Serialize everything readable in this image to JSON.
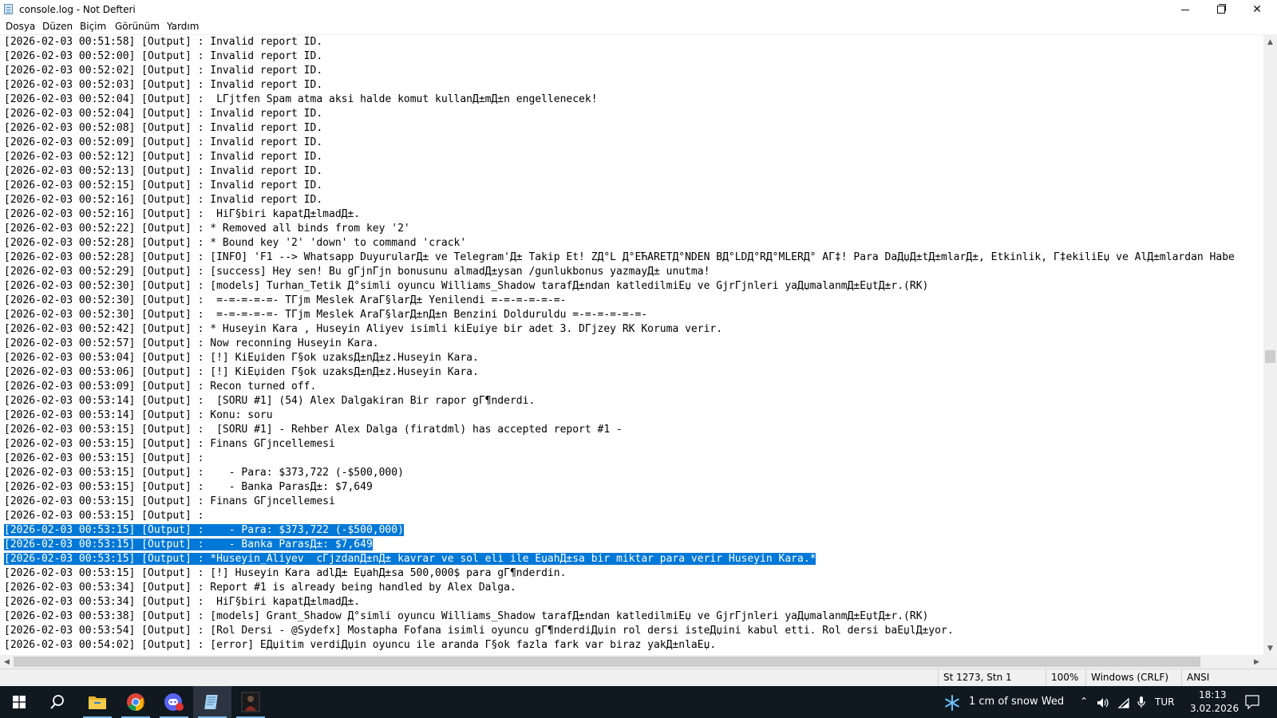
{
  "window": {
    "title": "console.log - Not Defteri"
  },
  "menu": [
    "Dosya",
    "Düzen",
    "Biçim",
    "Görünüm",
    "Yardım"
  ],
  "log_lines": [
    {
      "pre": "[2026-02-03 00:51:58] [Output] : Invalid report ID."
    },
    {
      "pre": "[2026-02-03 00:52:00] [Output] : Invalid report ID."
    },
    {
      "pre": "[2026-02-03 00:52:02] [Output] : Invalid report ID."
    },
    {
      "pre": "[2026-02-03 00:52:03] [Output] : Invalid report ID."
    },
    {
      "pre": "[2026-02-03 00:52:04] [Output] :  LГјtfen Spam atma aksi halde komut kullanД±mД±n engellenecek!"
    },
    {
      "pre": "[2026-02-03 00:52:04] [Output] : Invalid report ID."
    },
    {
      "pre": "[2026-02-03 00:52:08] [Output] : Invalid report ID."
    },
    {
      "pre": "[2026-02-03 00:52:09] [Output] : Invalid report ID."
    },
    {
      "pre": "[2026-02-03 00:52:12] [Output] : Invalid report ID."
    },
    {
      "pre": "[2026-02-03 00:52:13] [Output] : Invalid report ID."
    },
    {
      "pre": "[2026-02-03 00:52:15] [Output] : Invalid report ID."
    },
    {
      "pre": "[2026-02-03 00:52:16] [Output] : Invalid report ID."
    },
    {
      "pre": "[2026-02-03 00:52:16] [Output] :  HiГ§biri kapatД±lmadД±."
    },
    {
      "pre": "[2026-02-03 00:52:22] [Output] : * Removed all binds from key '2'"
    },
    {
      "pre": "[2026-02-03 00:52:28] [Output] : * Bound key '2' 'down' to command 'crack'"
    },
    {
      "pre": "[2026-02-03 00:52:28] [Output] : [INFO] 'F1 --> Whatsapp DuyurularД± ve Telegram'Д± Takip Et! ZД°L Д°EЋARETД°NDEN BД°LDД°RД°MLERД° AГ‡! Para DaДџД±tД±mlarД±, Etkinlik, Г‡ekiliЕџ ve AlД±mlardan Habe"
    },
    {
      "pre": "[2026-02-03 00:52:29] [Output] : [success] Hey sen! Bu gГјnГјn bonusunu almadД±ysan /gunlukbonus yazmayД± unutma!"
    },
    {
      "pre": "[2026-02-03 00:52:30] [Output] : [models] Turhan_Tetik Д°simli oyuncu Williams_Shadow tarafД±ndan katledilmiЕџ ve GјrГјnleri yaДџmalanmД±ЕџtД±r.(RK)"
    },
    {
      "pre": "[2026-02-03 00:52:30] [Output] :  =-=-=-=-=- TГјm Meslek AraГ§larД± Yenilendi =-=-=-=-=-=-"
    },
    {
      "pre": "[2026-02-03 00:52:30] [Output] :  =-=-=-=-=- TГјm Meslek AraГ§larД±nД±n Benzini Dolduruldu =-=-=-=-=-=-"
    },
    {
      "pre": "[2026-02-03 00:52:42] [Output] : * Huseyin Kara , Huseyin Aliyev isimli kiЕџiye bir adet 3. DГјzey RK Koruma verir."
    },
    {
      "pre": "[2026-02-03 00:52:57] [Output] : Now reconning Huseyin Kara."
    },
    {
      "pre": "[2026-02-03 00:53:04] [Output] : [!] KiЕџiden Г§ok uzaksД±nД±z.Huseyin Kara."
    },
    {
      "pre": "[2026-02-03 00:53:06] [Output] : [!] KiЕџiden Г§ok uzaksД±nД±z.Huseyin Kara."
    },
    {
      "pre": "[2026-02-03 00:53:09] [Output] : Recon turned off."
    },
    {
      "pre": "[2026-02-03 00:53:14] [Output] :  [SORU #1] (54) Alex Dalgakiran Bir rapor gГ¶nderdi."
    },
    {
      "pre": "[2026-02-03 00:53:14] [Output] : Konu: soru"
    },
    {
      "pre": "[2026-02-03 00:53:15] [Output] :  [SORU #1] - Rehber Alex Dalga (firatdml) has accepted report #1 -"
    },
    {
      "pre": "[2026-02-03 00:53:15] [Output] : Finans GГјncellemesi"
    },
    {
      "pre": "[2026-02-03 00:53:15] [Output] :"
    },
    {
      "pre": "[2026-02-03 00:53:15] [Output] :    - Para: $373,722 (-$500,000)"
    },
    {
      "pre": "[2026-02-03 00:53:15] [Output] :    - Banka ParasД±: $7,649"
    },
    {
      "pre": "[2026-02-03 00:53:15] [Output] : Finans GГјncellemesi"
    },
    {
      "pre": "[2026-02-03 00:53:15] [Output] :"
    },
    {
      "pre": "",
      "sel": "[2026-02-03 00:53:15] [Output] :    - Para: $373,722 (-$500,000)"
    },
    {
      "pre": "",
      "sel": "[2026-02-03 00:53:15] [Output] :    - Banka ParasД±: $7,649"
    },
    {
      "pre": "",
      "sel": "[2026-02-03 00:53:15] [Output] : *Huseyin_Aliyev  cГјzdanД±nД± kavrar ve sol eli ile EџahД±sa bir miktar para verir Huseyin Kara.*"
    },
    {
      "pre": "[2026-02-03 00:53:15] [Output] : [!] Huseyin Kara adlД± EџahД±sa 500,000$ para gГ¶nderdin."
    },
    {
      "pre": "[2026-02-03 00:53:34] [Output] : Report #1 is already being handled by Alex Dalga."
    },
    {
      "pre": "[2026-02-03 00:53:34] [Output] :  HiГ§biri kapatД±lmadД±."
    },
    {
      "pre": "[2026-02-03 00:53:38] [Output] : [models] Grant_Shadow Д°simli oyuncu Williams_Shadow tarafД±ndan katledilmiЕџ ve GјrГјnleri yaДџmalanmД±ЕџtД±r.(RK)"
    },
    {
      "pre": "[2026-02-03 00:53:54] [Output] : [Rol Dersi - @Sydefx] Mostapha Fofana isimli oyuncu gГ¶nderdiДџin rol dersi isteДџini kabul etti. Rol dersi baЕџlД±yor."
    },
    {
      "pre": "[2026-02-03 00:54:02] [Output] : [error] EДџitim verdiДџin oyuncu ile aranda Г§ok fazla fark var biraz yakД±nlaЕџ."
    }
  ],
  "status": {
    "position": "St 1273, Stn 1",
    "zoom": "100%",
    "line_ending": "Windows (CRLF)",
    "encoding": "ANSI"
  },
  "taskbar": {
    "weather": "1 cm of snow Wed",
    "language": "TUR",
    "time": "18:13",
    "date": "3.02.2026"
  },
  "colors": {
    "selection": "#0078d7",
    "taskbar": "#101820"
  }
}
